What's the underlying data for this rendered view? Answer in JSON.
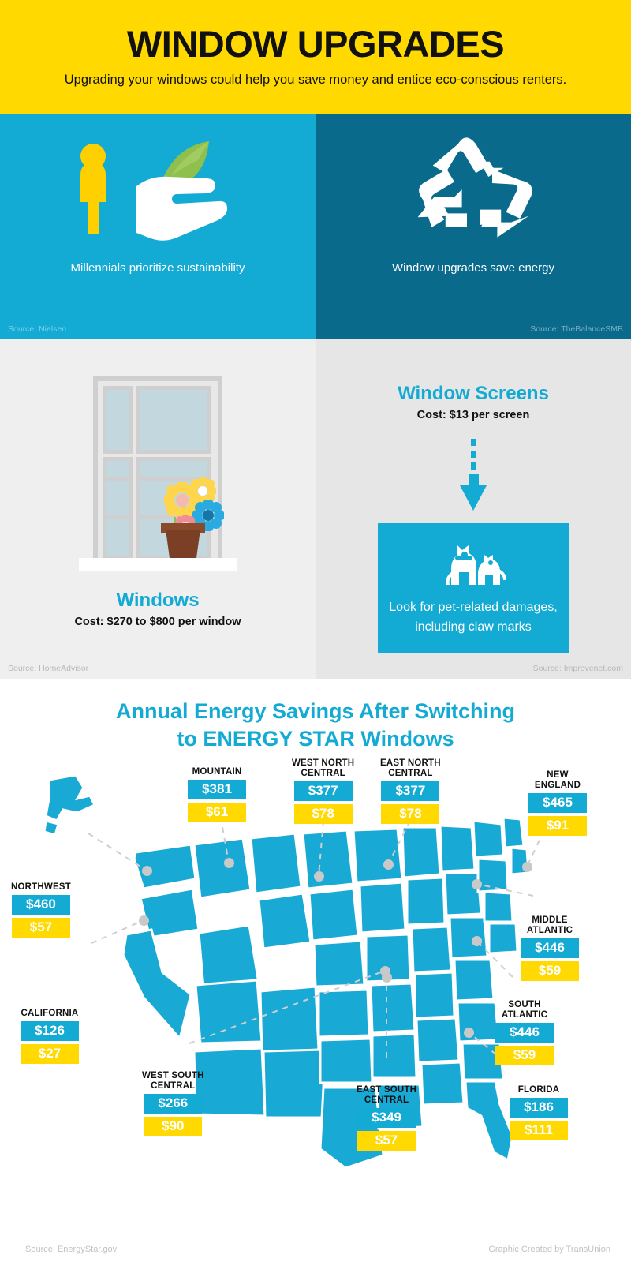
{
  "header": {
    "title": "WINDOW UPGRADES",
    "subtitle": "Upgrading your windows could help you save money and entice eco-conscious renters."
  },
  "panels": [
    {
      "caption": "Millennials prioritize sustainability",
      "source": "Source: Nielsen",
      "icon": "hand-leaf-icon",
      "bg": "#13AAD4"
    },
    {
      "caption": "Window upgrades save energy",
      "source": "Source: TheBalanceSMB",
      "icon": "recycle-icon",
      "bg": "#0A6A8C"
    }
  ],
  "costs": {
    "windows": {
      "title": "Windows",
      "cost": "Cost: $270 to $800 per window",
      "source": "Source: HomeAdvisor"
    },
    "screens": {
      "title": "Window Screens",
      "cost": "Cost: $13 per screen",
      "note": "Look for pet-related damages, including claw marks",
      "source": "Source: Improvenet.com"
    }
  },
  "map": {
    "title_line1": "Annual Energy Savings After Switching",
    "title_line2_prefix": "to ",
    "title_line2_bold": "ENERGY STAR",
    "title_line2_suffix": " Windows",
    "source": "Source: EnergyStar.gov",
    "credit": "Graphic Created by TransUnion"
  },
  "chart_data": {
    "type": "map",
    "title": "Annual Energy Savings After Switching to ENERGY STAR Windows",
    "unit": "USD per year",
    "series": [
      {
        "name": "primary-savings",
        "color": "#13AAD4"
      },
      {
        "name": "secondary-savings",
        "color": "#FFD900"
      }
    ],
    "regions": [
      {
        "name": "NORTHWEST",
        "blue": "$460",
        "yellow": "$57",
        "blue_value": 460,
        "yellow_value": 57
      },
      {
        "name": "MOUNTAIN",
        "blue": "$381",
        "yellow": "$61",
        "blue_value": 381,
        "yellow_value": 61
      },
      {
        "name": "WEST NORTH\nCENTRAL",
        "blue": "$377",
        "yellow": "$78",
        "blue_value": 377,
        "yellow_value": 78
      },
      {
        "name": "EAST NORTH\nCENTRAL",
        "blue": "$377",
        "yellow": "$78",
        "blue_value": 377,
        "yellow_value": 78
      },
      {
        "name": "NEW\nENGLAND",
        "blue": "$465",
        "yellow": "$91",
        "blue_value": 465,
        "yellow_value": 91
      },
      {
        "name": "MIDDLE\nATLANTIC",
        "blue": "$446",
        "yellow": "$59",
        "blue_value": 446,
        "yellow_value": 59
      },
      {
        "name": "CALIFORNIA",
        "blue": "$126",
        "yellow": "$27",
        "blue_value": 126,
        "yellow_value": 27
      },
      {
        "name": "SOUTH\nATLANTIC",
        "blue": "$446",
        "yellow": "$59",
        "blue_value": 446,
        "yellow_value": 59
      },
      {
        "name": "WEST SOUTH\nCENTRAL",
        "blue": "$266",
        "yellow": "$90",
        "blue_value": 266,
        "yellow_value": 90
      },
      {
        "name": "EAST SOUTH\nCENTRAL",
        "blue": "$349",
        "yellow": "$57",
        "blue_value": 349,
        "yellow_value": 57
      },
      {
        "name": "FLORIDA",
        "blue": "$186",
        "yellow": "$111",
        "blue_value": 186,
        "yellow_value": 111
      }
    ]
  },
  "colors": {
    "yellow": "#FFD900",
    "cyan": "#13AAD4",
    "teal": "#0A6A8C",
    "grey": "#EFEFEF"
  }
}
